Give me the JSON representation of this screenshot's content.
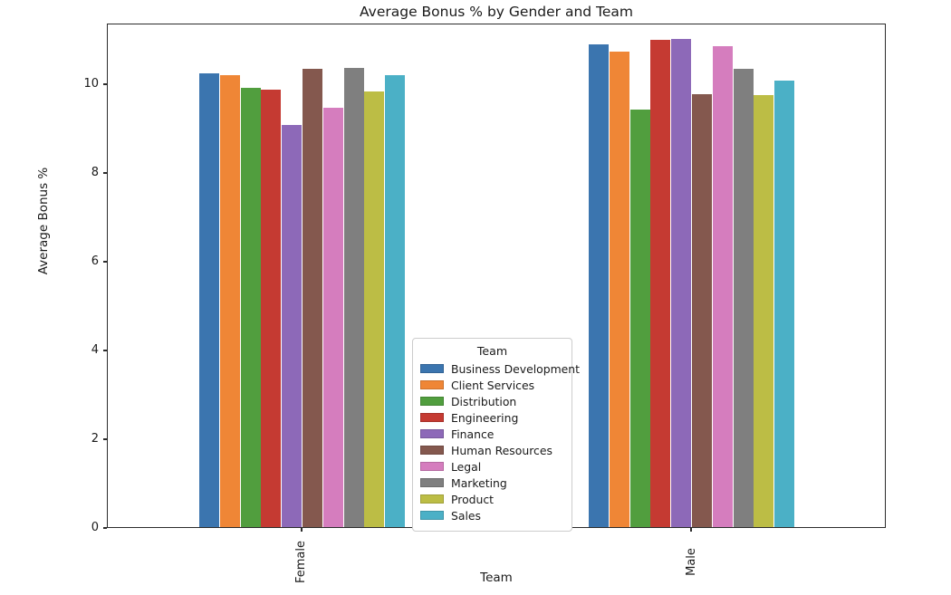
{
  "chart_data": {
    "type": "bar",
    "title": "Average Bonus % by Gender and Team",
    "xlabel": "Team",
    "ylabel": "Average Bonus %",
    "categories": [
      "Female",
      "Male"
    ],
    "ylim": [
      0,
      11.4
    ],
    "yticks": [
      0,
      2,
      4,
      6,
      8,
      10
    ],
    "grid": false,
    "legend_title": "Team",
    "legend_position": "center",
    "series": [
      {
        "name": "Business Development",
        "color": "#3b75af",
        "values": [
          10.22,
          10.87
        ]
      },
      {
        "name": "Client Services",
        "color": "#ef8636",
        "values": [
          10.18,
          10.71
        ]
      },
      {
        "name": "Distribution",
        "color": "#519e3e",
        "values": [
          9.9,
          9.4
        ]
      },
      {
        "name": "Engineering",
        "color": "#c53a32",
        "values": [
          9.86,
          10.97
        ]
      },
      {
        "name": "Finance",
        "color": "#8d69b8",
        "values": [
          9.06,
          11.0
        ]
      },
      {
        "name": "Human Resources",
        "color": "#84584e",
        "values": [
          10.33,
          9.75
        ]
      },
      {
        "name": "Legal",
        "color": "#d57dbe",
        "values": [
          9.44,
          10.84
        ]
      },
      {
        "name": "Marketing",
        "color": "#7f7f7f",
        "values": [
          10.34,
          10.32
        ]
      },
      {
        "name": "Product",
        "color": "#bcbd45",
        "values": [
          9.82,
          9.74
        ]
      },
      {
        "name": "Sales",
        "color": "#4bb0c6",
        "values": [
          10.19,
          10.06
        ]
      }
    ]
  }
}
